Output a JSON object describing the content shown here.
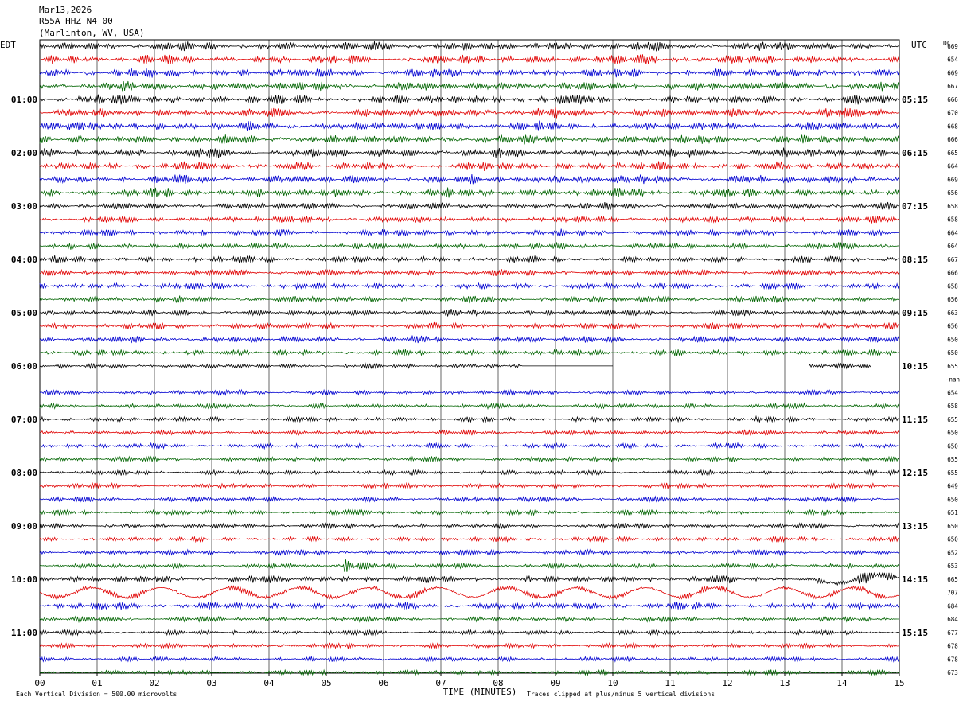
{
  "header": {
    "date": "Mar13,2026",
    "station": "R55A HHZ N4 00",
    "location": "(Marlinton, WV, USA)"
  },
  "left_tz": "EDT",
  "right_tz": "UTC",
  "dc_label": "DC",
  "footer": {
    "scale_note": "Each Vertical Division =  500.00 microvolts",
    "xlabel": "TIME (MINUTES)",
    "clip_note": "Traces clipped at plus/minus 5 vertical divisions"
  },
  "chart_data": {
    "type": "line",
    "xlabel": "TIME (MINUTES)",
    "xlim": [
      0,
      15
    ],
    "x_ticks": [
      "00",
      "01",
      "02",
      "03",
      "04",
      "05",
      "06",
      "07",
      "08",
      "09",
      "10",
      "11",
      "12",
      "13",
      "14",
      "15"
    ],
    "row_count": 48,
    "trace_colors": [
      "#000000",
      "#e00000",
      "#0000d0",
      "#006400"
    ],
    "left_hour_labels": [
      "01:00",
      "02:00",
      "03:00",
      "04:00",
      "05:00",
      "06:00",
      "07:00",
      "08:00",
      "09:00",
      "10:00",
      "11:00"
    ],
    "right_hour_labels": [
      "05:15",
      "06:15",
      "07:15",
      "08:15",
      "09:15",
      "10:15",
      "11:15",
      "12:15",
      "13:15",
      "14:15",
      "15:15"
    ],
    "dc_values": [
      "669",
      "654",
      "669",
      "667",
      "666",
      "670",
      "668",
      "666",
      "665",
      "664",
      "669",
      "656",
      "658",
      "658",
      "664",
      "664",
      "667",
      "666",
      "658",
      "656",
      "663",
      "656",
      "650",
      "650",
      "655",
      "-nan",
      "654",
      "658",
      "655",
      "650",
      "650",
      "655",
      "655",
      "649",
      "650",
      "651",
      "650",
      "650",
      "652",
      "653",
      "665",
      "707",
      "684",
      "684",
      "677",
      "678",
      "678",
      "673"
    ],
    "gap_rows": [
      {
        "row": 24,
        "gaps": [
          [
            8.4,
            10.0
          ],
          [
            10.0,
            13.4
          ],
          [
            14.5,
            15.0
          ]
        ]
      },
      {
        "row": 25,
        "gaps": [
          [
            0.0,
            15.0
          ]
        ]
      }
    ],
    "events": [
      {
        "row": 39,
        "minute": 5.3,
        "amplitude": "clipped"
      },
      {
        "row": 40,
        "minute": 14.2,
        "amplitude": "large"
      }
    ]
  }
}
